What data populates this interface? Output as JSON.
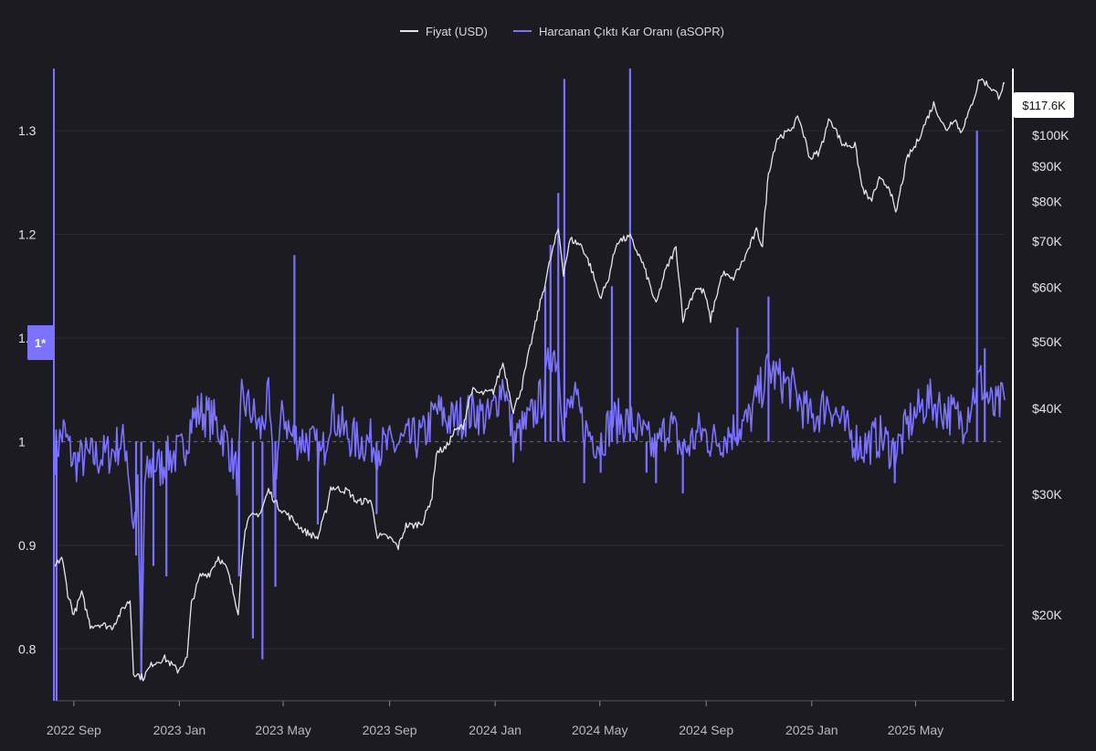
{
  "legend": {
    "price_label": "Fiyat (USD)",
    "asopr_label": "Harcanan Çıktı Kar Oranı (aSOPR)"
  },
  "current_price_label": "$117.6K",
  "ref_marker_label": "1*",
  "colors": {
    "background": "#1c1b22",
    "price_line": "#e6e6ea",
    "asopr_line": "#7b72ff",
    "axis": "#ffffff"
  },
  "chart_data": {
    "type": "line",
    "title": "",
    "xlabel": "",
    "ylabel": "",
    "x_range": [
      "2022-08-10",
      "2025-08-12"
    ],
    "y_left": {
      "name": "aSOPR",
      "ticks": [
        0.8,
        0.9,
        1,
        1.1,
        1.2,
        1.3
      ],
      "tick_labels": [
        "0.8",
        "0.9",
        "1",
        "1.1",
        "1.2",
        "1.3"
      ],
      "range": [
        0.75,
        1.36
      ],
      "reference_line": 1.0
    },
    "y_right": {
      "name": "Price (USD)",
      "scale": "log",
      "ticks": [
        20000,
        30000,
        40000,
        50000,
        60000,
        70000,
        80000,
        90000,
        100000
      ],
      "tick_labels": [
        "$20K",
        "$30K",
        "$40K",
        "$50K",
        "$60K",
        "$70K",
        "$80K",
        "$90K",
        "$100K"
      ],
      "range": [
        15000,
        125000
      ]
    },
    "x_ticks": [
      {
        "date": "2022-09-01",
        "label": "2022 Sep"
      },
      {
        "date": "2023-01-01",
        "label": "2023 Jan"
      },
      {
        "date": "2023-05-01",
        "label": "2023 May"
      },
      {
        "date": "2023-09-01",
        "label": "2023 Sep"
      },
      {
        "date": "2024-01-01",
        "label": "2024 Jan"
      },
      {
        "date": "2024-05-01",
        "label": "2024 May"
      },
      {
        "date": "2024-09-01",
        "label": "2024 Sep"
      },
      {
        "date": "2025-01-01",
        "label": "2025 Jan"
      },
      {
        "date": "2025-05-01",
        "label": "2025 May"
      }
    ],
    "grid": true,
    "legend_position": "top-center",
    "series": [
      {
        "name": "Fiyat (USD)",
        "axis": "right",
        "points": [
          [
            "2022-08-10",
            23500
          ],
          [
            "2022-08-18",
            24300
          ],
          [
            "2022-08-25",
            21500
          ],
          [
            "2022-09-01",
            20000
          ],
          [
            "2022-09-10",
            21500
          ],
          [
            "2022-09-20",
            19300
          ],
          [
            "2022-10-01",
            19400
          ],
          [
            "2022-10-15",
            19200
          ],
          [
            "2022-10-30",
            20600
          ],
          [
            "2022-11-05",
            21000
          ],
          [
            "2022-11-09",
            16500
          ],
          [
            "2022-11-20",
            16200
          ],
          [
            "2022-12-01",
            17000
          ],
          [
            "2022-12-15",
            17300
          ],
          [
            "2022-12-30",
            16600
          ],
          [
            "2023-01-10",
            17300
          ],
          [
            "2023-01-15",
            20800
          ],
          [
            "2023-01-25",
            22800
          ],
          [
            "2023-02-05",
            23000
          ],
          [
            "2023-02-15",
            24300
          ],
          [
            "2023-02-25",
            23300
          ],
          [
            "2023-03-10",
            20200
          ],
          [
            "2023-03-18",
            26900
          ],
          [
            "2023-03-25",
            27800
          ],
          [
            "2023-04-05",
            28200
          ],
          [
            "2023-04-14",
            30400
          ],
          [
            "2023-04-25",
            28800
          ],
          [
            "2023-05-10",
            27700
          ],
          [
            "2023-05-25",
            26500
          ],
          [
            "2023-06-10",
            25900
          ],
          [
            "2023-06-20",
            28500
          ],
          [
            "2023-06-25",
            30700
          ],
          [
            "2023-07-05",
            30500
          ],
          [
            "2023-07-15",
            30300
          ],
          [
            "2023-07-25",
            29200
          ],
          [
            "2023-08-10",
            29400
          ],
          [
            "2023-08-18",
            26100
          ],
          [
            "2023-09-01",
            25900
          ],
          [
            "2023-09-11",
            25100
          ],
          [
            "2023-09-20",
            27000
          ],
          [
            "2023-09-30",
            27000
          ],
          [
            "2023-10-10",
            27400
          ],
          [
            "2023-10-20",
            29700
          ],
          [
            "2023-10-25",
            34500
          ],
          [
            "2023-11-05",
            35000
          ],
          [
            "2023-11-15",
            37000
          ],
          [
            "2023-11-25",
            37700
          ],
          [
            "2023-12-05",
            42500
          ],
          [
            "2023-12-15",
            42000
          ],
          [
            "2023-12-30",
            42300
          ],
          [
            "2024-01-10",
            46500
          ],
          [
            "2024-01-22",
            39600
          ],
          [
            "2024-02-01",
            43000
          ],
          [
            "2024-02-15",
            52000
          ],
          [
            "2024-02-28",
            61000
          ],
          [
            "2024-03-05",
            66000
          ],
          [
            "2024-03-14",
            73000
          ],
          [
            "2024-03-20",
            63000
          ],
          [
            "2024-03-28",
            70500
          ],
          [
            "2024-04-10",
            69000
          ],
          [
            "2024-04-20",
            64500
          ],
          [
            "2024-05-01",
            58000
          ],
          [
            "2024-05-10",
            61000
          ],
          [
            "2024-05-21",
            70000
          ],
          [
            "2024-06-05",
            71000
          ],
          [
            "2024-06-20",
            64800
          ],
          [
            "2024-07-05",
            56500
          ],
          [
            "2024-07-15",
            63000
          ],
          [
            "2024-07-28",
            68500
          ],
          [
            "2024-08-05",
            54000
          ],
          [
            "2024-08-20",
            60000
          ],
          [
            "2024-08-30",
            59000
          ],
          [
            "2024-09-06",
            53800
          ],
          [
            "2024-09-20",
            63000
          ],
          [
            "2024-10-01",
            61500
          ],
          [
            "2024-10-15",
            66000
          ],
          [
            "2024-10-29",
            72500
          ],
          [
            "2024-11-05",
            69000
          ],
          [
            "2024-11-12",
            88000
          ],
          [
            "2024-11-22",
            99000
          ],
          [
            "2024-12-05",
            101000
          ],
          [
            "2024-12-17",
            106000
          ],
          [
            "2024-12-30",
            92500
          ],
          [
            "2025-01-10",
            94500
          ],
          [
            "2025-01-22",
            106000
          ],
          [
            "2025-02-05",
            97000
          ],
          [
            "2025-02-20",
            96500
          ],
          [
            "2025-02-28",
            84000
          ],
          [
            "2025-03-10",
            80000
          ],
          [
            "2025-03-20",
            86000
          ],
          [
            "2025-04-01",
            84000
          ],
          [
            "2025-04-08",
            76500
          ],
          [
            "2025-04-22",
            93000
          ],
          [
            "2025-05-01",
            96500
          ],
          [
            "2025-05-12",
            104000
          ],
          [
            "2025-05-22",
            111000
          ],
          [
            "2025-06-05",
            101500
          ],
          [
            "2025-06-15",
            106000
          ],
          [
            "2025-06-22",
            101000
          ],
          [
            "2025-07-01",
            107000
          ],
          [
            "2025-07-10",
            116000
          ],
          [
            "2025-07-14",
            121000
          ],
          [
            "2025-07-25",
            118000
          ],
          [
            "2025-08-05",
            114000
          ],
          [
            "2025-08-12",
            119000
          ]
        ]
      },
      {
        "name": "Harcanan Çıktı Kar Oranı (aSOPR)",
        "axis": "left",
        "points": [
          [
            "2022-08-10",
            0.99
          ],
          [
            "2022-08-20",
            1.01
          ],
          [
            "2022-09-01",
            0.98
          ],
          [
            "2022-09-15",
            0.985
          ],
          [
            "2022-10-01",
            0.985
          ],
          [
            "2022-10-15",
            0.99
          ],
          [
            "2022-10-25",
            1.0
          ],
          [
            "2022-11-01",
            0.995
          ],
          [
            "2022-11-09",
            0.915
          ],
          [
            "2022-11-14",
            0.95
          ],
          [
            "2022-11-18",
            0.77
          ],
          [
            "2022-11-22",
            0.96
          ],
          [
            "2022-12-01",
            0.98
          ],
          [
            "2022-12-10",
            0.975
          ],
          [
            "2022-12-20",
            0.985
          ],
          [
            "2023-01-05",
            0.99
          ],
          [
            "2023-01-15",
            1.02
          ],
          [
            "2023-01-25",
            1.03
          ],
          [
            "2023-02-10",
            1.02
          ],
          [
            "2023-02-25",
            1.0
          ],
          [
            "2023-03-10",
            0.965
          ],
          [
            "2023-03-14",
            1.04
          ],
          [
            "2023-03-25",
            1.03
          ],
          [
            "2023-04-05",
            1.01
          ],
          [
            "2023-04-14",
            1.04
          ],
          [
            "2023-04-20",
            0.96
          ],
          [
            "2023-05-01",
            1.03
          ],
          [
            "2023-05-10",
            1.005
          ],
          [
            "2023-06-01",
            1.0
          ],
          [
            "2023-06-15",
            0.985
          ],
          [
            "2023-06-25",
            1.03
          ],
          [
            "2023-07-10",
            1.01
          ],
          [
            "2023-07-25",
            1.0
          ],
          [
            "2023-08-10",
            1.0
          ],
          [
            "2023-08-18",
            0.995
          ],
          [
            "2023-09-01",
            0.995
          ],
          [
            "2023-09-20",
            1.0
          ],
          [
            "2023-10-10",
            1.005
          ],
          [
            "2023-10-25",
            1.03
          ],
          [
            "2023-11-10",
            1.02
          ],
          [
            "2023-11-25",
            1.025
          ],
          [
            "2023-12-10",
            1.03
          ],
          [
            "2023-12-25",
            1.02
          ],
          [
            "2024-01-11",
            1.06
          ],
          [
            "2024-01-22",
            1.0
          ],
          [
            "2024-02-10",
            1.02
          ],
          [
            "2024-02-28",
            1.05
          ],
          [
            "2024-03-05",
            1.09
          ],
          [
            "2024-03-14",
            1.08
          ],
          [
            "2024-03-20",
            1.02
          ],
          [
            "2024-04-01",
            1.04
          ],
          [
            "2024-04-15",
            1.01
          ],
          [
            "2024-05-01",
            1.0
          ],
          [
            "2024-05-15",
            1.02
          ],
          [
            "2024-06-05",
            1.02
          ],
          [
            "2024-06-25",
            1.0
          ],
          [
            "2024-07-05",
            0.99
          ],
          [
            "2024-07-20",
            1.02
          ],
          [
            "2024-08-05",
            0.99
          ],
          [
            "2024-08-25",
            1.01
          ],
          [
            "2024-09-10",
            1.0
          ],
          [
            "2024-10-01",
            1.01
          ],
          [
            "2024-10-20",
            1.02
          ],
          [
            "2024-11-12",
            1.07
          ],
          [
            "2024-11-25",
            1.06
          ],
          [
            "2024-12-10",
            1.05
          ],
          [
            "2025-01-01",
            1.02
          ],
          [
            "2025-01-20",
            1.04
          ],
          [
            "2025-02-10",
            1.01
          ],
          [
            "2025-03-01",
            0.995
          ],
          [
            "2025-03-20",
            1.005
          ],
          [
            "2025-04-08",
            0.99
          ],
          [
            "2025-04-25",
            1.02
          ],
          [
            "2025-05-15",
            1.04
          ],
          [
            "2025-06-05",
            1.03
          ],
          [
            "2025-06-25",
            1.02
          ],
          [
            "2025-07-14",
            1.06
          ],
          [
            "2025-07-30",
            1.03
          ],
          [
            "2025-08-12",
            1.04
          ]
        ],
        "spikes": [
          [
            "2022-08-12",
            0.75
          ],
          [
            "2022-11-12",
            0.89
          ],
          [
            "2022-11-18",
            0.77
          ],
          [
            "2022-12-02",
            0.88
          ],
          [
            "2022-12-17",
            0.87
          ],
          [
            "2023-03-11",
            0.87
          ],
          [
            "2023-03-27",
            0.81
          ],
          [
            "2023-04-07",
            0.79
          ],
          [
            "2023-04-22",
            0.86
          ],
          [
            "2023-05-14",
            1.18
          ],
          [
            "2023-06-10",
            0.92
          ],
          [
            "2023-08-17",
            0.93
          ],
          [
            "2024-02-28",
            1.15
          ],
          [
            "2024-03-05",
            1.19
          ],
          [
            "2024-03-14",
            1.24
          ],
          [
            "2024-03-21",
            1.35
          ],
          [
            "2024-04-13",
            0.96
          ],
          [
            "2024-05-02",
            0.97
          ],
          [
            "2024-05-15",
            1.15
          ],
          [
            "2024-06-05",
            1.36
          ],
          [
            "2024-06-24",
            0.97
          ],
          [
            "2024-07-05",
            0.96
          ],
          [
            "2024-08-05",
            0.95
          ],
          [
            "2024-10-07",
            1.11
          ],
          [
            "2024-11-12",
            1.14
          ],
          [
            "2025-04-07",
            0.96
          ],
          [
            "2025-07-11",
            1.3
          ],
          [
            "2025-07-20",
            1.09
          ]
        ]
      }
    ]
  }
}
